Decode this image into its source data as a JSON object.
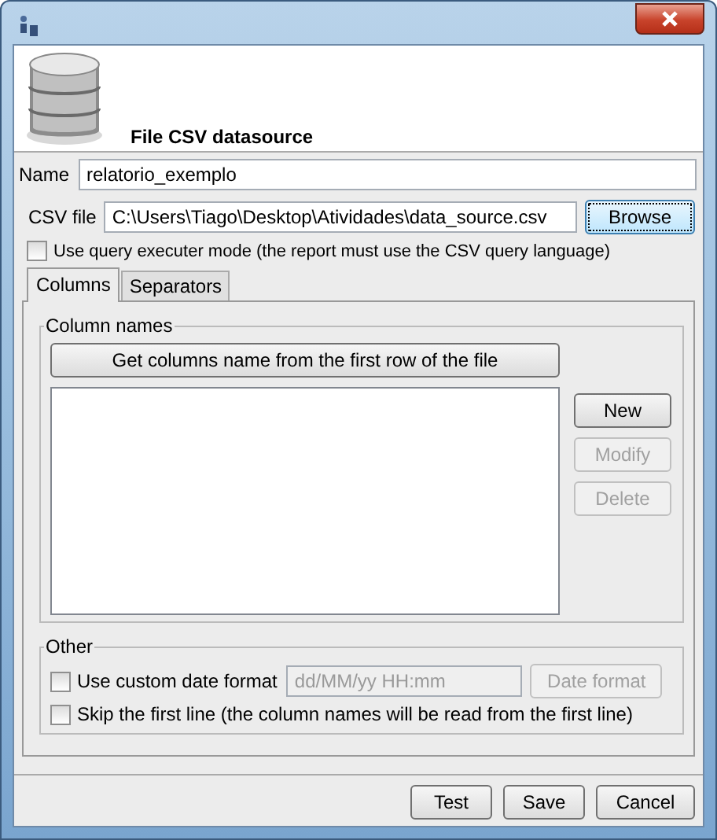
{
  "header": {
    "title": "File CSV datasource"
  },
  "name_field": {
    "label": "Name",
    "value": "relatorio_exemplo"
  },
  "csv_file": {
    "label": "CSV file",
    "value": "C:\\Users\\Tiago\\Desktop\\Atividades\\data_source.csv",
    "button": "Browse"
  },
  "query_mode": {
    "label": "Use query executer mode (the report must use the CSV query language)",
    "checked": false
  },
  "tabs": [
    {
      "label": "Columns",
      "selected": true
    },
    {
      "label": "Separators",
      "selected": false
    }
  ],
  "column_names": {
    "title": "Column names",
    "get_button": "Get columns name from the first row of the file",
    "buttons": [
      {
        "label": "New",
        "disabled": false
      },
      {
        "label": "Modify",
        "disabled": true
      },
      {
        "label": "Delete",
        "disabled": true
      }
    ]
  },
  "other": {
    "title": "Other",
    "custom_date": {
      "label": "Use custom date format",
      "checked": false,
      "placeholder": "dd/MM/yy HH:mm",
      "button": "Date format",
      "disabled": true
    },
    "skip_first": {
      "label": "Skip the first line (the column names will be read from the first line)",
      "checked": false
    }
  },
  "buttons": [
    "Test",
    "Save",
    "Cancel"
  ]
}
